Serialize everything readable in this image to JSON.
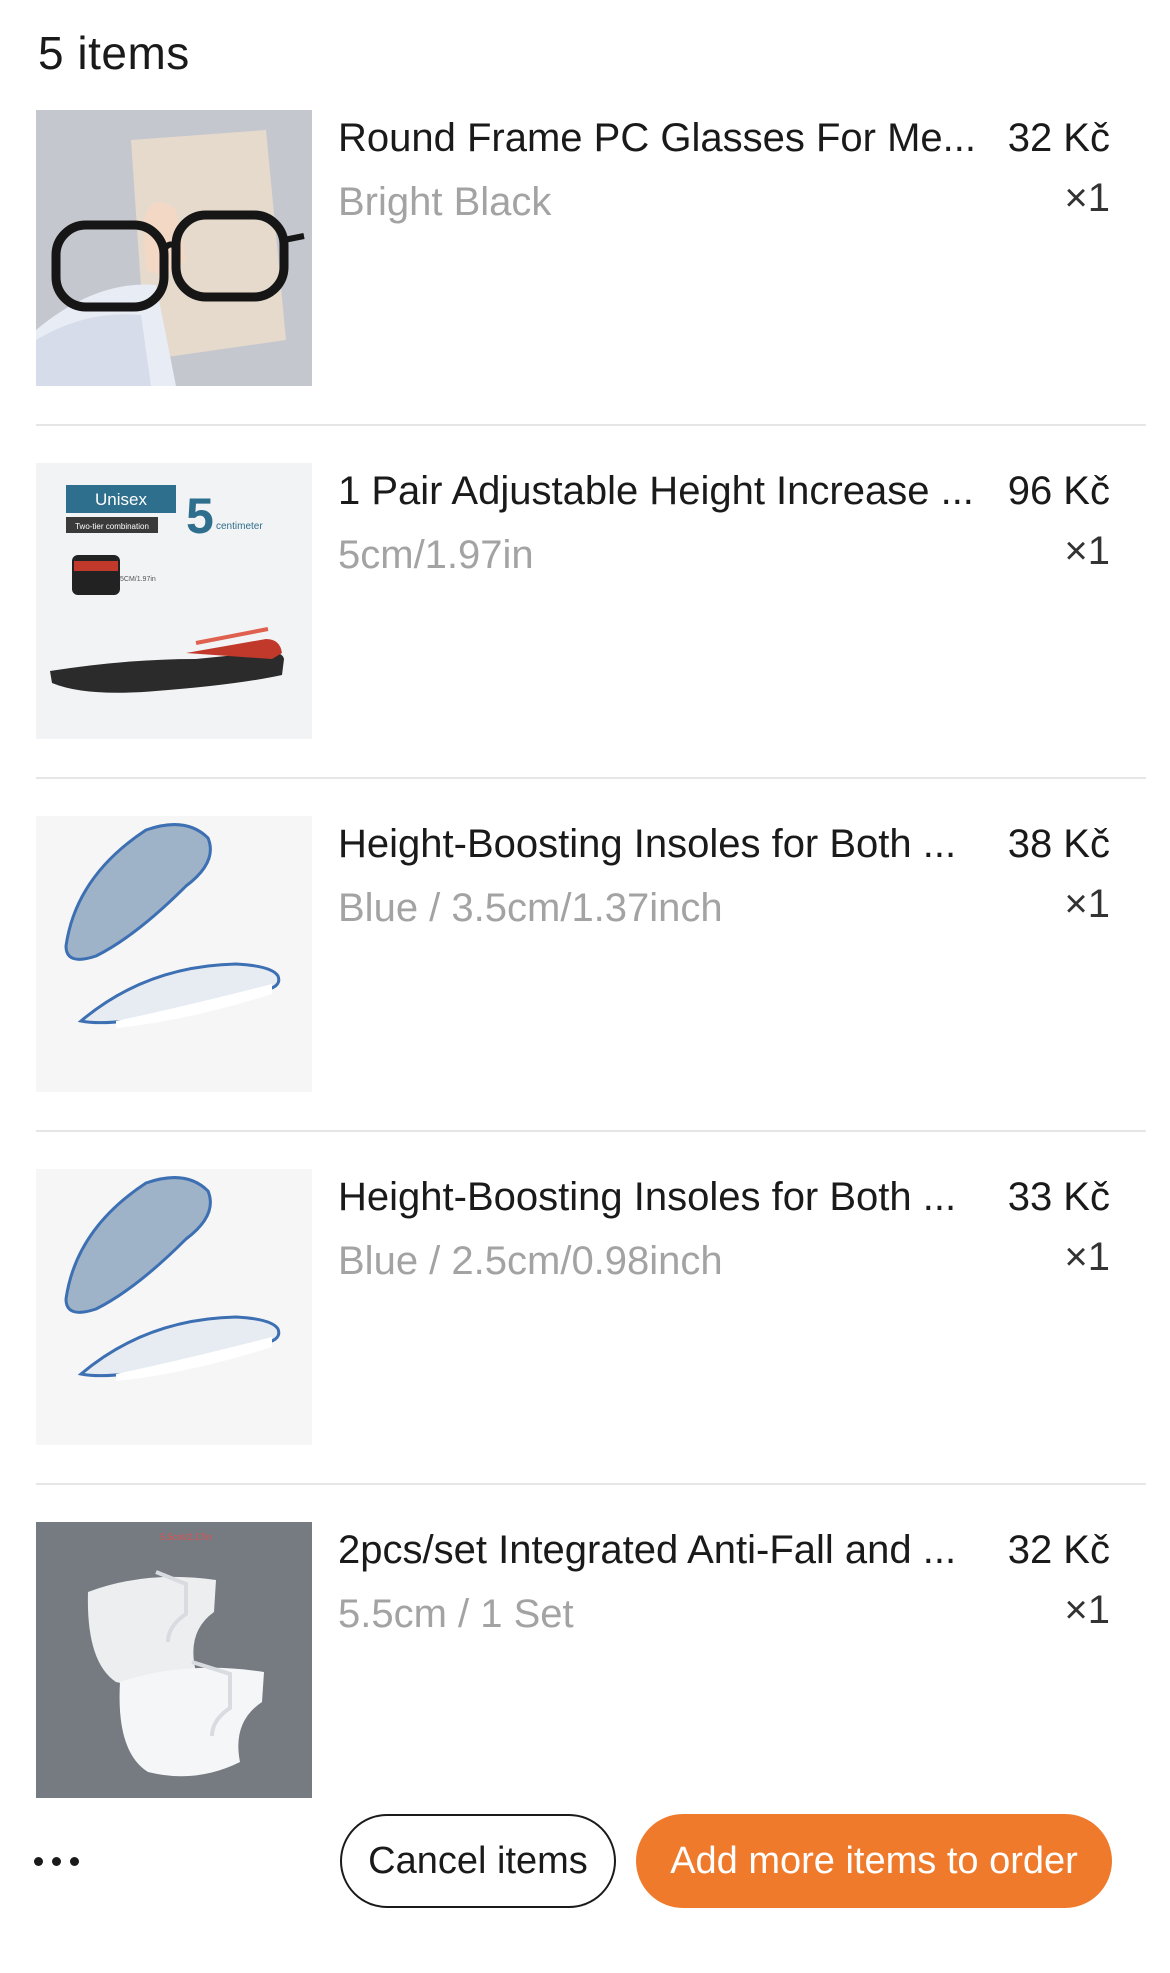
{
  "header": {
    "count_label": "5 items"
  },
  "items": [
    {
      "name": "Round Frame PC Glasses For Me...",
      "price": "32 Kč",
      "variant": "Bright Black",
      "qty": "×1"
    },
    {
      "name": "1 Pair Adjustable Height Increase ...",
      "price": "96 Kč",
      "variant": "5cm/1.97in",
      "qty": "×1",
      "image_text": {
        "badge": "Unisex",
        "sub": "Two-tier combination",
        "number": "5",
        "unit": "centimeter",
        "dim": "5CM/1.97in"
      }
    },
    {
      "name": "Height-Boosting Insoles for Both ...",
      "price": "38 Kč",
      "variant": "Blue / 3.5cm/1.37inch",
      "qty": "×1"
    },
    {
      "name": "Height-Boosting Insoles for Both ...",
      "price": "33 Kč",
      "variant": "Blue / 2.5cm/0.98inch",
      "qty": "×1"
    },
    {
      "name": "2pcs/set Integrated Anti-Fall and ...",
      "price": "32 Kč",
      "variant": "5.5cm / 1 Set",
      "qty": "×1",
      "image_text": {
        "dim": "5.5cm/2.17in"
      }
    }
  ],
  "actions": {
    "cancel_label": "Cancel items",
    "add_label": "Add more items to order"
  },
  "colors": {
    "accent": "#f07a2b",
    "muted_text": "#a3a3a3",
    "divider": "#e6e6e6"
  }
}
